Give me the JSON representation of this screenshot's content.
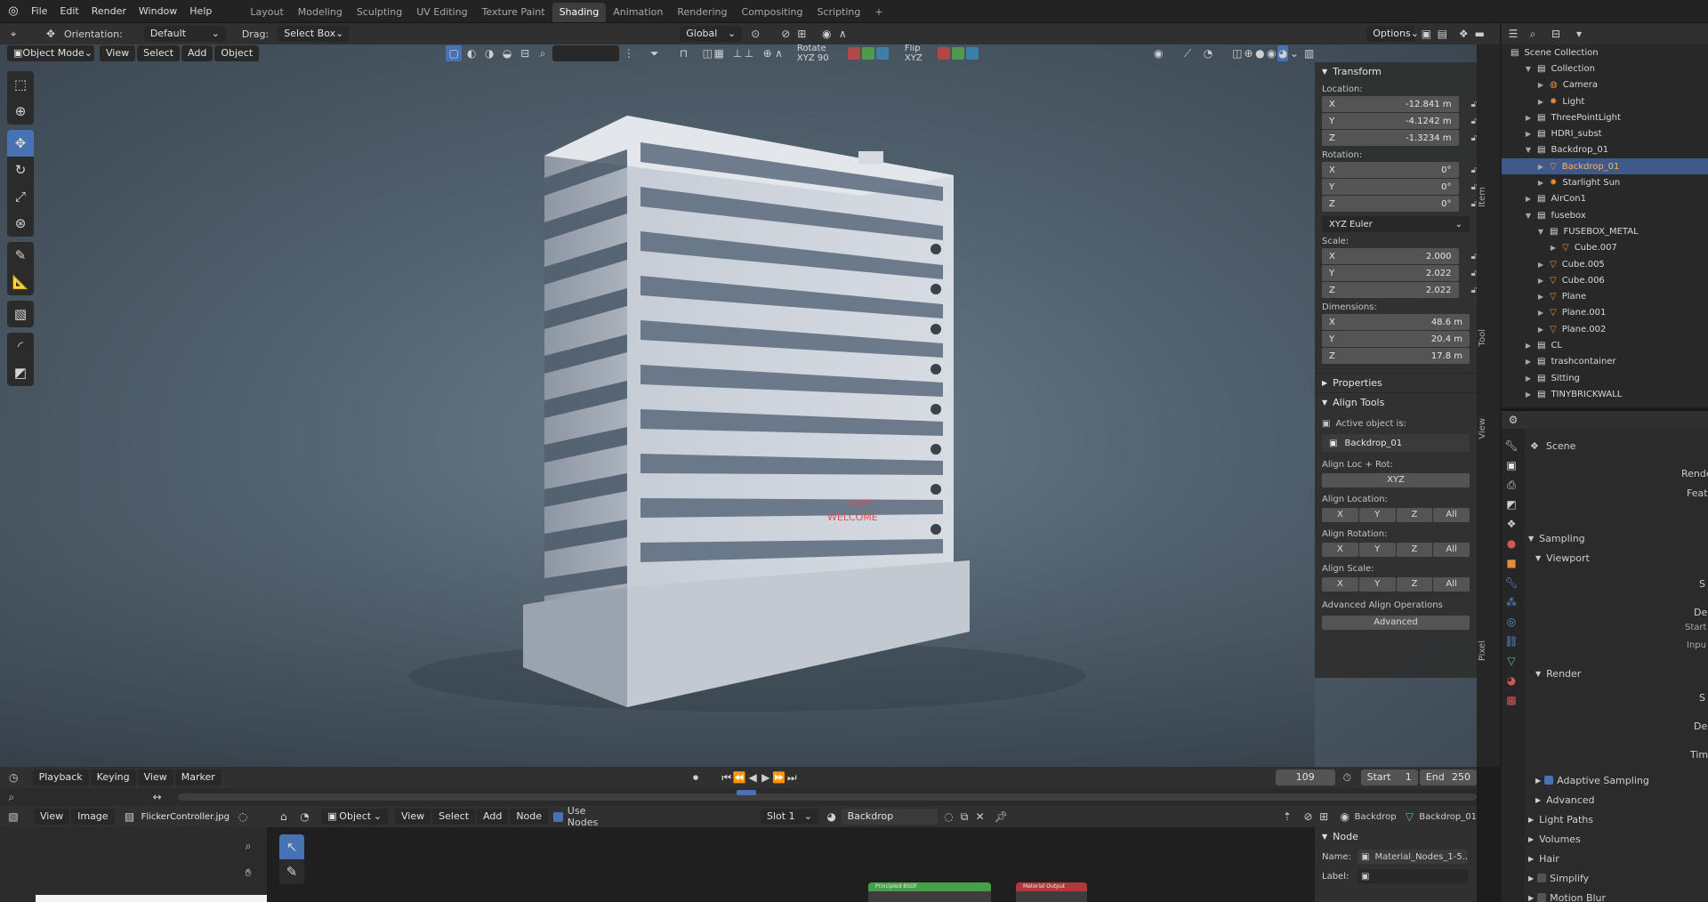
{
  "topbar": {
    "menus": [
      "File",
      "Edit",
      "Render",
      "Window",
      "Help"
    ],
    "workspaces": [
      "Layout",
      "Modeling",
      "Sculpting",
      "UV Editing",
      "Texture Paint",
      "Shading",
      "Animation",
      "Rendering",
      "Compositing",
      "Scripting"
    ],
    "active_workspace": "Shading",
    "add_tab": "+"
  },
  "tool_header": {
    "orientation_label": "Orientation:",
    "orientation_value": "Default",
    "drag_label": "Drag:",
    "drag_value": "Select Box",
    "transform_orientation": "Global",
    "options_label": "Options"
  },
  "viewport_header": {
    "mode": "Object Mode",
    "menus": [
      "View",
      "Select",
      "Add",
      "Object"
    ],
    "rotate_label": "Rotate XYZ 90",
    "flip_label": "Flip XYZ"
  },
  "viewport": {
    "sign_text_1": "NOT",
    "sign_text_2": "WELCOME"
  },
  "npanel": {
    "transform_title": "Transform",
    "location_label": "Location:",
    "location": {
      "x": "-12.841 m",
      "y": "-4.1242 m",
      "z": "-1.3234 m"
    },
    "rotation_label": "Rotation:",
    "rotation": {
      "x": "0°",
      "y": "0°",
      "z": "0°"
    },
    "rotation_mode": "XYZ Euler",
    "scale_label": "Scale:",
    "scale": {
      "x": "2.000",
      "y": "2.022",
      "z": "2.022"
    },
    "dimensions_label": "Dimensions:",
    "dimensions": {
      "x": "48.6 m",
      "y": "20.4 m",
      "z": "17.8 m"
    },
    "properties_title": "Properties",
    "align_tools_title": "Align Tools",
    "active_object_label": "Active object is:",
    "active_object_name": "Backdrop_01",
    "align_loc_rot_label": "Align Loc + Rot:",
    "align_loc_rot_button": "XYZ",
    "align_location_label": "Align Location:",
    "align_rotation_label": "Align Rotation:",
    "align_scale_label": "Align Scale:",
    "axis_buttons": [
      "X",
      "Y",
      "Z",
      "All"
    ],
    "advanced_label": "Advanced Align Operations",
    "advanced_button": "Advanced",
    "side_tabs": [
      "Item",
      "Tool",
      "View",
      "Pixel"
    ]
  },
  "outliner": {
    "root": "Scene Collection",
    "rows": [
      {
        "name": "Collection",
        "indent": 1,
        "icon": "collection",
        "expanded": true
      },
      {
        "name": "Camera",
        "indent": 2,
        "icon": "camera"
      },
      {
        "name": "Light",
        "indent": 2,
        "icon": "light"
      },
      {
        "name": "ThreePointLight",
        "indent": 1,
        "icon": "collection"
      },
      {
        "name": "HDRI_subst",
        "indent": 1,
        "icon": "collection"
      },
      {
        "name": "Backdrop_01",
        "indent": 1,
        "icon": "collection",
        "expanded": true
      },
      {
        "name": "Backdrop_01",
        "indent": 2,
        "icon": "mesh",
        "selected": true
      },
      {
        "name": "Starlight Sun",
        "indent": 2,
        "icon": "light"
      },
      {
        "name": "AirCon1",
        "indent": 1,
        "icon": "collection"
      },
      {
        "name": "fusebox",
        "indent": 1,
        "icon": "collection",
        "expanded": true
      },
      {
        "name": "FUSEBOX_METAL",
        "indent": 2,
        "icon": "collection",
        "expanded": true
      },
      {
        "name": "Cube.007",
        "indent": 3,
        "icon": "mesh"
      },
      {
        "name": "Cube.005",
        "indent": 2,
        "icon": "mesh"
      },
      {
        "name": "Cube.006",
        "indent": 2,
        "icon": "mesh"
      },
      {
        "name": "Plane",
        "indent": 2,
        "icon": "mesh"
      },
      {
        "name": "Plane.001",
        "indent": 2,
        "icon": "mesh"
      },
      {
        "name": "Plane.002",
        "indent": 2,
        "icon": "mesh"
      },
      {
        "name": "CL",
        "indent": 1,
        "icon": "collection"
      },
      {
        "name": "trashcontainer",
        "indent": 1,
        "icon": "collection"
      },
      {
        "name": "Sitting",
        "indent": 1,
        "icon": "collection"
      },
      {
        "name": "TINYBRICKWALL",
        "indent": 1,
        "icon": "collection"
      }
    ]
  },
  "properties": {
    "scene_label": "Scene",
    "render_cut": "Rende",
    "feat_cut": "Feat",
    "sampling": "Sampling",
    "viewport": "Viewport",
    "render": "Render",
    "adaptive_sampling": "Adaptive Sampling",
    "advanced": "Advanced",
    "light_paths": "Light Paths",
    "volumes": "Volumes",
    "hair": "Hair",
    "simplify": "Simplify",
    "motion_blur": "Motion Blur",
    "cut_s": "S",
    "cut_de": "De",
    "cut_start": "Start",
    "cut_input": "Inpu",
    "cut_s2": "S",
    "cut_de2": "De",
    "cut_tim": "Tim"
  },
  "timeline": {
    "menus": [
      "Playback",
      "Keying",
      "View",
      "Marker"
    ],
    "current_frame": "109",
    "start_label": "Start",
    "start_value": "1",
    "end_label": "End",
    "end_value": "250",
    "current_frame_progress": 0.432
  },
  "image_editor": {
    "menus": [
      "View",
      "Image"
    ],
    "image_name": "FlickerController.jpg"
  },
  "node_editor": {
    "object_label": "Object",
    "menus": [
      "View",
      "Select",
      "Add",
      "Node"
    ],
    "use_nodes_label": "Use Nodes",
    "slot": "Slot 1",
    "material": "Backdrop",
    "right_object": "Backdrop",
    "right_mesh": "Backdrop_01",
    "node_panel_title": "Node",
    "name_label": "Name:",
    "name_value": "Material_Nodes_1-5...",
    "label_label": "Label:",
    "node1_title": "Principled BSDF",
    "node2_title": "Material Output"
  },
  "colors": {
    "accent": "#4772b3",
    "selected_row": "#3f5a8a",
    "object_orange": "#e88a3a",
    "mesh_green": "#58c08a"
  }
}
